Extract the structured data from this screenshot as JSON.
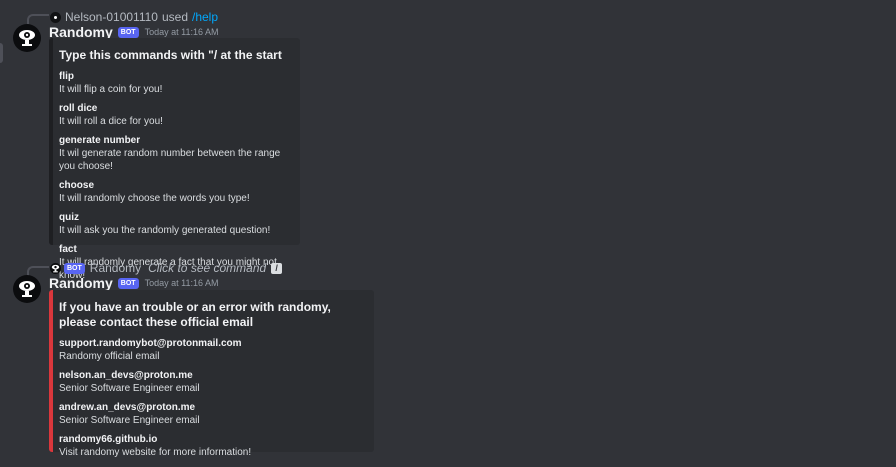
{
  "colors": {
    "background": "#313338",
    "embed_bg": "#2b2d31",
    "help_accent": "#1e1f22",
    "contact_accent": "#da373c",
    "link": "#00a8fc",
    "bot_tag": "#5865f2"
  },
  "message1": {
    "reply": {
      "user": "Nelson-01001110",
      "action": "used",
      "command": "/help"
    },
    "author": "Randomy",
    "bot_tag": "BOT",
    "timestamp": "Today at 11:16 AM",
    "embed": {
      "title": "Type this commands with \"/ at the start",
      "fields": [
        {
          "name": "flip",
          "value": "It will flip a coin for you!"
        },
        {
          "name": "roll dice",
          "value": "It will roll a dice for you!"
        },
        {
          "name": "generate number",
          "value": "It wil generate random number between the range you choose!"
        },
        {
          "name": "choose",
          "value": "It will randomly choose the words you type!"
        },
        {
          "name": "quiz",
          "value": "It will ask you the randomly generated question!"
        },
        {
          "name": "fact",
          "value": "It will randomly generate a fact that you might not know!"
        }
      ]
    }
  },
  "message2": {
    "reply": {
      "bot_tag": "BOT",
      "user": "Randomy",
      "hint": "Click to see command"
    },
    "author": "Randomy",
    "bot_tag": "BOT",
    "timestamp": "Today at 11:16 AM",
    "embed": {
      "title": "If you have an trouble or an error with randomy, please contact these official email",
      "fields": [
        {
          "name": "support.randomybot@protonmail.com",
          "value": "Randomy official email"
        },
        {
          "name": "nelson.an_devs@proton.me",
          "value": "Senior Software Engineer email"
        },
        {
          "name": "andrew.an_devs@proton.me",
          "value": "Senior Software Engineer email"
        },
        {
          "name": "randomy66.github.io",
          "value": "Visit randomy website for more information!"
        }
      ]
    }
  }
}
